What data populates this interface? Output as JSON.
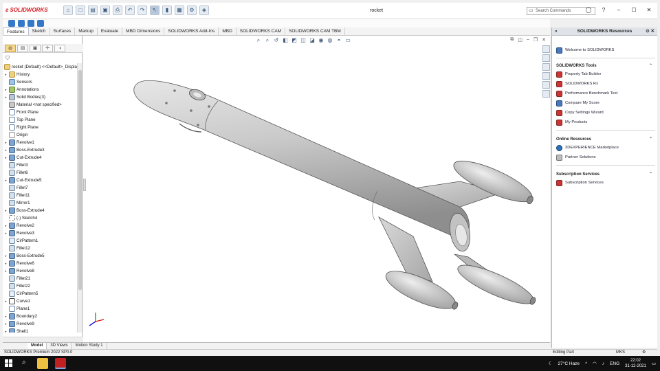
{
  "app": {
    "name": "SOLIDWORKS",
    "doc_title": "rocket",
    "search_placeholder": "Search Commands"
  },
  "command_tabs": [
    "Features",
    "Sketch",
    "Surfaces",
    "Markup",
    "Evaluate",
    "MBD Dimensions",
    "SOLIDWORKS Add-Ins",
    "MBD",
    "SOLIDWORKS CAM",
    "SOLIDWORKS CAM TBM"
  ],
  "feature_tree": {
    "root": "rocket (Default) <<Default>_Displa",
    "items": [
      {
        "label": "History",
        "icon": "folder"
      },
      {
        "label": "Sensors",
        "icon": "sensor"
      },
      {
        "label": "Annotations",
        "icon": "annot"
      },
      {
        "label": "Solid Bodies(3)",
        "icon": "solid"
      },
      {
        "label": "Material <not specified>",
        "icon": "mat"
      },
      {
        "label": "Front Plane",
        "icon": "plane"
      },
      {
        "label": "Top Plane",
        "icon": "plane"
      },
      {
        "label": "Right Plane",
        "icon": "plane"
      },
      {
        "label": "Origin",
        "icon": "origin"
      },
      {
        "label": "Revolve1",
        "icon": "feat"
      },
      {
        "label": "Boss-Extrude3",
        "icon": "feat"
      },
      {
        "label": "Cut-Extrude4",
        "icon": "feat"
      },
      {
        "label": "Fillet3",
        "icon": "fillet"
      },
      {
        "label": "Fillet6",
        "icon": "fillet"
      },
      {
        "label": "Cut-Extrude5",
        "icon": "feat"
      },
      {
        "label": "Fillet7",
        "icon": "fillet"
      },
      {
        "label": "Fillet11",
        "icon": "fillet"
      },
      {
        "label": "Mirror1",
        "icon": "fillet"
      },
      {
        "label": "Boss-Extrude4",
        "icon": "feat"
      },
      {
        "label": "(-) Sketch4",
        "icon": "sketch"
      },
      {
        "label": "Revolve2",
        "icon": "feat"
      },
      {
        "label": "Revolve3",
        "icon": "feat"
      },
      {
        "label": "CirPattern1",
        "icon": "pattern"
      },
      {
        "label": "Fillet12",
        "icon": "fillet"
      },
      {
        "label": "Boss-Extrude5",
        "icon": "feat"
      },
      {
        "label": "Revolve6",
        "icon": "feat"
      },
      {
        "label": "Revolve8",
        "icon": "feat"
      },
      {
        "label": "Fillet21",
        "icon": "fillet"
      },
      {
        "label": "Fillet22",
        "icon": "fillet"
      },
      {
        "label": "CirPattern5",
        "icon": "pattern"
      },
      {
        "label": "Curve1",
        "icon": "curve"
      },
      {
        "label": "Plane1",
        "icon": "plane"
      },
      {
        "label": "Boundary2",
        "icon": "feat"
      },
      {
        "label": "Revolve9",
        "icon": "feat"
      },
      {
        "label": "Shell1",
        "icon": "feat"
      }
    ]
  },
  "model_tabs": [
    "Model",
    "3D Views",
    "Motion Study 1"
  ],
  "task_pane": {
    "title": "SOLIDWORKS Resources",
    "welcome": "Welcome to SOLIDWORKS",
    "tools_title": "SOLIDWORKS Tools",
    "tools": [
      "Property Tab Builder",
      "SOLIDWORKS Rx",
      "Performance Benchmark Test",
      "Compare My Score",
      "Copy Settings Wizard",
      "My Products"
    ],
    "online_title": "Online Resources",
    "online": [
      "3DEXPERIENCE Marketplace",
      "Partner Solutions"
    ],
    "subs_title": "Subscription Services",
    "subs": [
      "Subscription Services"
    ]
  },
  "status_bar": {
    "version": "SOLIDWORKS Premium 2022 SP0.0",
    "mode": "Editing Part",
    "units": "MKS"
  },
  "taskbar": {
    "weather": "27°C  Haze",
    "lang": "ENG",
    "time": "22:02",
    "date": "31-12-2021"
  },
  "colors": {
    "brand_red": "#d71920",
    "model_gray": "#b9b9b9"
  }
}
